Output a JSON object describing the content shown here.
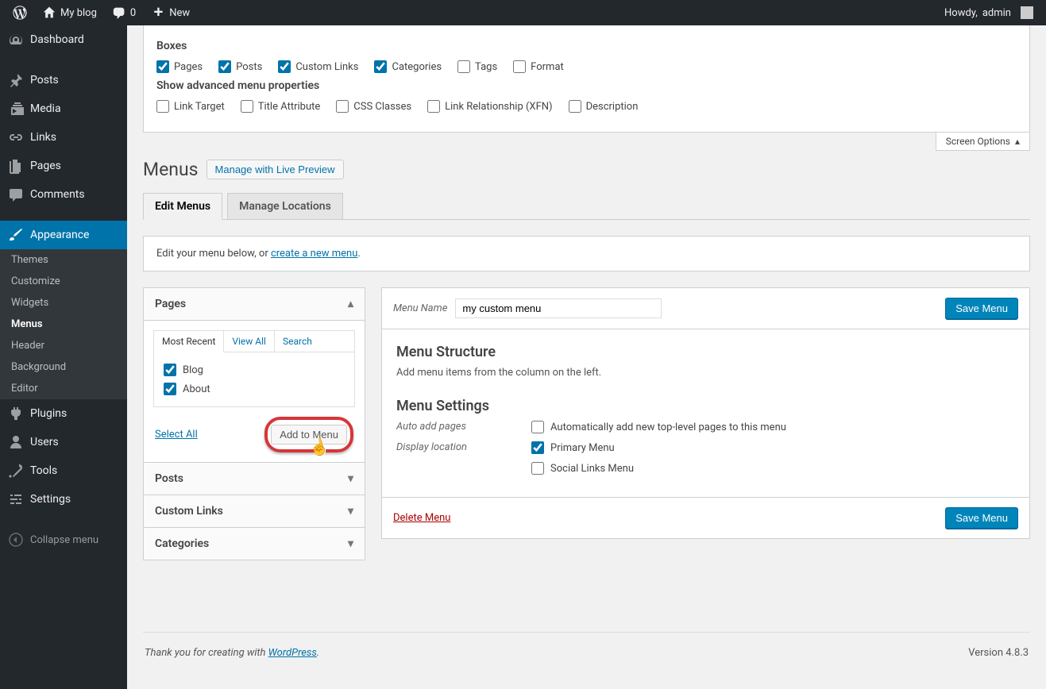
{
  "adminbar": {
    "site_name": "My blog",
    "comments_count": "0",
    "new_label": "New",
    "howdy_prefix": "Howdy,",
    "user_name": "admin"
  },
  "sidebar": {
    "items": [
      {
        "label": "Dashboard",
        "icon": "dashboard"
      },
      {
        "label": "Posts",
        "icon": "pin"
      },
      {
        "label": "Media",
        "icon": "media"
      },
      {
        "label": "Links",
        "icon": "link"
      },
      {
        "label": "Pages",
        "icon": "page"
      },
      {
        "label": "Comments",
        "icon": "comment"
      },
      {
        "label": "Appearance",
        "icon": "brush"
      },
      {
        "label": "Plugins",
        "icon": "plugin"
      },
      {
        "label": "Users",
        "icon": "user"
      },
      {
        "label": "Tools",
        "icon": "wrench"
      },
      {
        "label": "Settings",
        "icon": "sliders"
      }
    ],
    "appearance_sub": [
      "Themes",
      "Customize",
      "Widgets",
      "Menus",
      "Header",
      "Background",
      "Editor"
    ],
    "collapse_label": "Collapse menu"
  },
  "screen_options": {
    "toggle_label": "Screen Options",
    "boxes_heading": "Boxes",
    "boxes": [
      {
        "label": "Pages",
        "checked": true
      },
      {
        "label": "Posts",
        "checked": true
      },
      {
        "label": "Custom Links",
        "checked": true
      },
      {
        "label": "Categories",
        "checked": true
      },
      {
        "label": "Tags",
        "checked": false
      },
      {
        "label": "Format",
        "checked": false
      }
    ],
    "advanced_heading": "Show advanced menu properties",
    "advanced": [
      {
        "label": "Link Target",
        "checked": false
      },
      {
        "label": "Title Attribute",
        "checked": false
      },
      {
        "label": "CSS Classes",
        "checked": false
      },
      {
        "label": "Link Relationship (XFN)",
        "checked": false
      },
      {
        "label": "Description",
        "checked": false
      }
    ]
  },
  "page_title": "Menus",
  "live_preview_btn": "Manage with Live Preview",
  "tabs": {
    "edit": "Edit Menus",
    "locations": "Manage Locations"
  },
  "notice": {
    "text": "Edit your menu below, or ",
    "link": "create a new menu",
    "suffix": "."
  },
  "accordion": {
    "pages": {
      "title": "Pages",
      "mini_tabs": [
        "Most Recent",
        "View All",
        "Search"
      ],
      "items": [
        {
          "label": "Blog",
          "checked": true
        },
        {
          "label": "About",
          "checked": true
        }
      ],
      "select_all": "Select All",
      "add_btn": "Add to Menu"
    },
    "posts_title": "Posts",
    "custom_title": "Custom Links",
    "categories_title": "Categories"
  },
  "menu": {
    "name_label": "Menu Name",
    "name_value": "my custom menu",
    "save_btn": "Save Menu",
    "structure_heading": "Menu Structure",
    "structure_desc": "Add menu items from the column on the left.",
    "settings_heading": "Menu Settings",
    "auto_add_label": "Auto add pages",
    "auto_add_option": "Automatically add new top-level pages to this menu",
    "display_label": "Display location",
    "locations": [
      {
        "label": "Primary Menu",
        "checked": true
      },
      {
        "label": "Social Links Menu",
        "checked": false
      }
    ],
    "delete_label": "Delete Menu"
  },
  "footer": {
    "thanks_prefix": "Thank you for creating with ",
    "wp_link": "WordPress",
    "version": "Version 4.8.3"
  }
}
